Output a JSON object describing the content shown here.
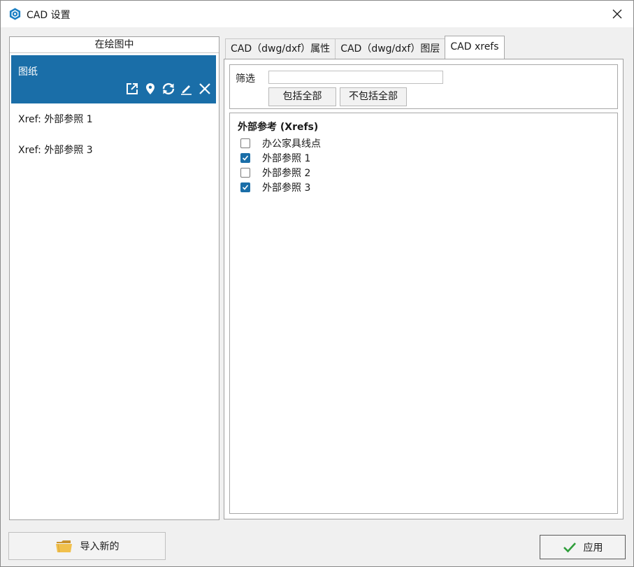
{
  "window": {
    "title": "CAD 设置",
    "close_symbol": "✕"
  },
  "icons": {
    "app": "cad-app-icon",
    "close": "close-icon",
    "export": "export-icon",
    "locate": "location-pin-icon",
    "reload": "reload-icon",
    "edit": "pencil-icon",
    "remove": "close-icon",
    "folder": "folder-icon",
    "apply": "checkmark-icon"
  },
  "colors": {
    "accent": "#1a6ea8",
    "apply_check": "#2e9e3a"
  },
  "left_panel": {
    "header": "在绘图中",
    "drawing": {
      "label": "图纸",
      "selected": true
    },
    "xref_items": [
      {
        "label": "Xref: 外部参照 1"
      },
      {
        "label": "Xref: 外部参照 3"
      }
    ]
  },
  "tabs": [
    {
      "label": "CAD（dwg/dxf）属性",
      "active": false
    },
    {
      "label": "CAD（dwg/dxf）图层",
      "active": false
    },
    {
      "label": "CAD xrefs",
      "active": true
    }
  ],
  "filter": {
    "label": "筛选",
    "value": "",
    "include_all": "包括全部",
    "exclude_all": "不包括全部"
  },
  "xrefs": {
    "title": "外部参考 (Xrefs)",
    "items": [
      {
        "label": "办公家具线点",
        "checked": false
      },
      {
        "label": "外部参照 1",
        "checked": true
      },
      {
        "label": "外部参照 2",
        "checked": false
      },
      {
        "label": "外部参照 3",
        "checked": true
      }
    ]
  },
  "footer": {
    "import_label": "导入新的",
    "apply_label": "应用"
  }
}
